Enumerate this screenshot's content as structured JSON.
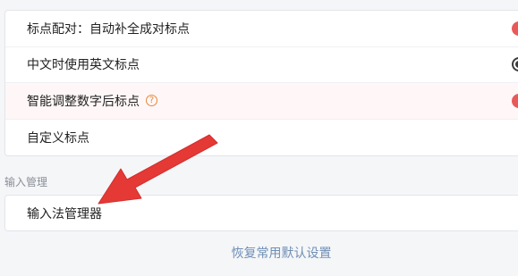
{
  "punctuation_section": {
    "items": [
      {
        "label": "标点配对：自动补全成对标点",
        "toggle": "on"
      },
      {
        "label": "中文时使用英文标点",
        "toggle": "off"
      },
      {
        "label": "智能调整数字后标点",
        "toggle": "on",
        "help_icon": "question-circle-icon"
      },
      {
        "label": "自定义标点"
      }
    ]
  },
  "input_management": {
    "header": "输入管理",
    "items": [
      {
        "label": "输入法管理器"
      }
    ]
  },
  "restore_link": "恢复常用默认设置",
  "colors": {
    "toggle_on": "#e85a5a",
    "arrow": "#e53935",
    "link": "#6f8fb5",
    "help_icon": "#e3893a"
  }
}
